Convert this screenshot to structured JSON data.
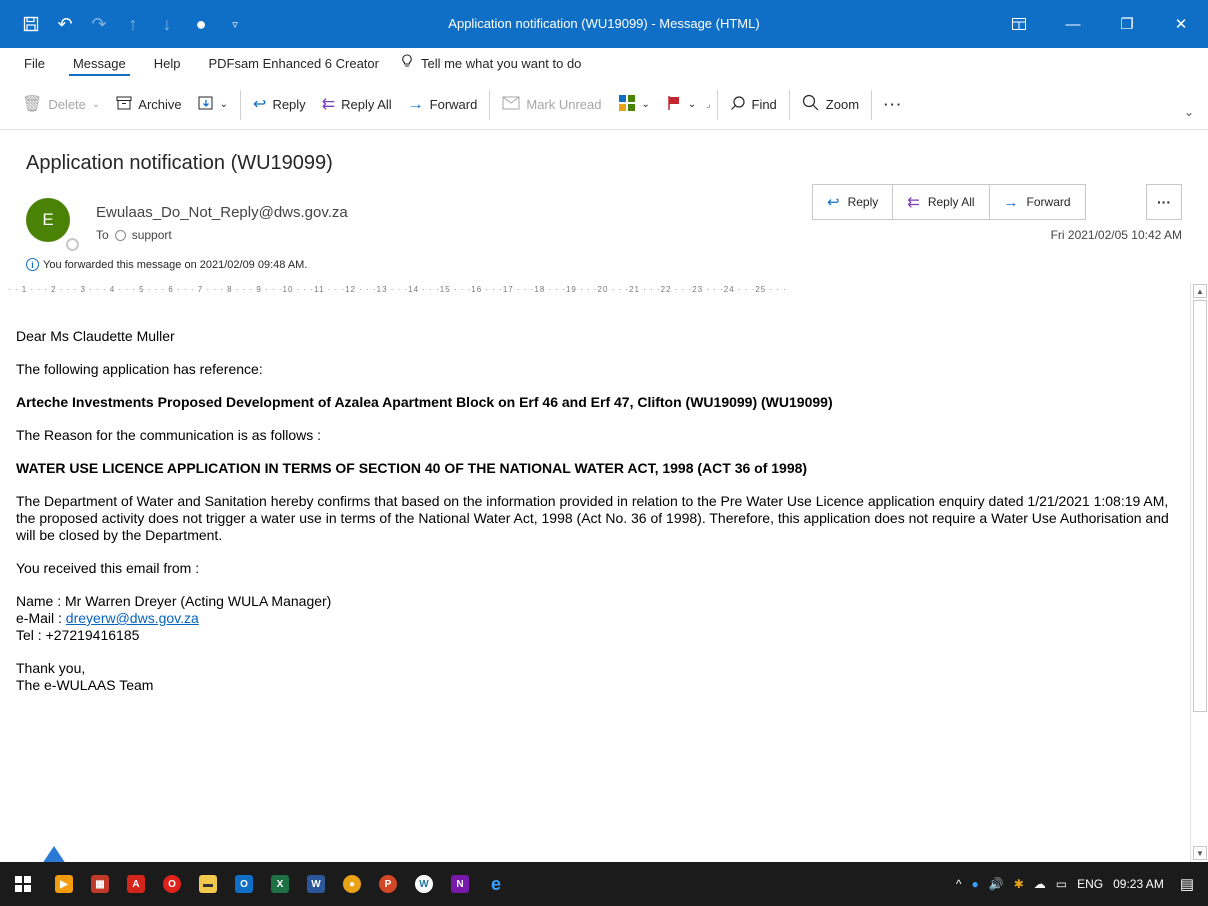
{
  "window": {
    "title": "Application notification (WU19099)  -  Message (HTML)"
  },
  "menu": {
    "items": [
      "File",
      "Message",
      "Help",
      "PDFsam Enhanced 6 Creator"
    ],
    "tell": "Tell me what you want to do"
  },
  "toolbar": {
    "delete": "Delete",
    "archive": "Archive",
    "reply": "Reply",
    "reply_all": "Reply All",
    "forward": "Forward",
    "mark_unread": "Mark Unread",
    "find": "Find",
    "zoom": "Zoom"
  },
  "message": {
    "subject": "Application notification (WU19099)",
    "avatar_initial": "E",
    "sender": "Ewulaas_Do_Not_Reply@dws.gov.za",
    "to_label": "To",
    "to_value": "support",
    "info": "You forwarded this message on 2021/02/09 09:48 AM.",
    "date": "Fri 2021/02/05 10:42 AM",
    "actions": {
      "reply": "Reply",
      "reply_all": "Reply All",
      "forward": "Forward"
    }
  },
  "ruler": "· · 1 · · · 2 · · · 3 · · · 4 · · · 5 · · · 6 · · · 7 · · · 8 · · · 9 · · ·10 · · ·11 · · ·12 · · ·13 · · ·14 · · ·15 · · ·16 · · ·17 · · ·18 · · ·19 · · ·20 · · ·21 · · ·22 · · ·23 · · ·24 · · ·25 · · ·",
  "body": {
    "greeting": "Dear Ms Claudette Muller",
    "line1": "The following application has reference:",
    "reference": "Arteche Investments Proposed Development of Azalea Apartment Block on Erf 46 and Erf 47, Clifton (WU19099)  (WU19099)",
    "line2": "The Reason for the communication is as follows :",
    "heading": "WATER USE LICENCE APPLICATION IN TERMS OF SECTION 40 OF THE NATIONAL WATER ACT, 1998 (ACT 36 of 1998)",
    "paragraph": "The Department of Water and Sanitation hereby confirms that based on the information provided in relation to the Pre Water Use Licence application enquiry dated 1/21/2021 1:08:19 AM, the proposed activity does not trigger a water use in terms of the National Water Act, 1998 (Act No. 36 of 1998). Therefore, this application does not require a Water Use Authorisation and will be closed by the Department.",
    "line3": "You received this email from :",
    "name_line": "Name : Mr Warren Dreyer (Acting WULA Manager)",
    "email_label": "e-Mail : ",
    "email_link": "dreyerw@dws.gov.za",
    "tel_line": "Tel : +27219416185",
    "thanks": "Thank you,",
    "team": "The e-WULAAS Team"
  },
  "taskbar": {
    "lang": "ENG",
    "time": "09:23 AM"
  },
  "colors": {
    "accent": "#0f6fc6",
    "avatar": "#498205",
    "taskbar": "#1b1b1b"
  }
}
